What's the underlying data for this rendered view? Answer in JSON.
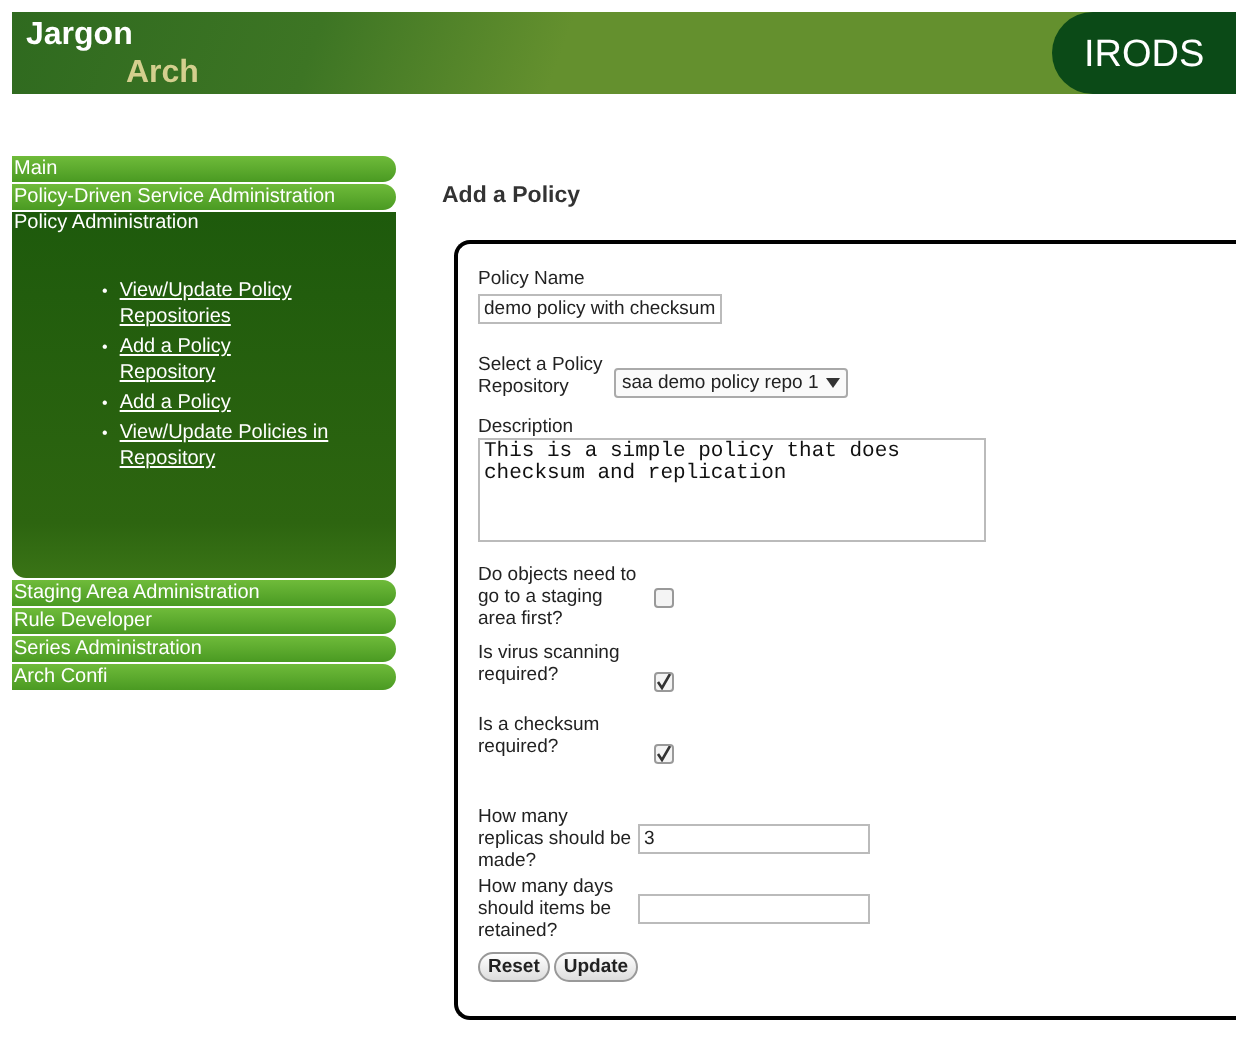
{
  "header": {
    "logo_line_1": "Jargon",
    "logo_line_2": "Arch",
    "badge": "IRODS"
  },
  "nav": [
    {
      "label": "Main",
      "expanded": false
    },
    {
      "label": "Policy-Driven Service Administration",
      "expanded": false
    },
    {
      "label": "Policy Administration",
      "expanded": true,
      "children": [
        {
          "marker": "•",
          "label": "View/Update Policy Repositories"
        },
        {
          "marker": "•",
          "label": "Add a Policy Repository"
        },
        {
          "marker": "•",
          "label": "Add a Policy"
        },
        {
          "marker": "•",
          "label": "View/Update Policies in Repository"
        }
      ]
    },
    {
      "label": "Staging Area Administration",
      "expanded": false
    },
    {
      "label": "Rule Developer",
      "expanded": false
    },
    {
      "label": "Series Administration",
      "expanded": false
    },
    {
      "label": "Arch Confi",
      "expanded": false
    }
  ],
  "page_title": "Add a Policy",
  "fields": [
    {
      "kind": "text",
      "label": "Policy Name",
      "value": "demo policy with checksum"
    },
    {
      "kind": "select",
      "label": "Select a Policy Repository",
      "value": "saa demo policy repo 1"
    },
    {
      "kind": "textarea",
      "label": "Description",
      "value": "This is a simple policy that does checksum and replication"
    },
    {
      "kind": "checkbox",
      "label": "Do objects need to go to a staging area first?",
      "checked": false
    },
    {
      "kind": "checkbox",
      "label": "Is virus scanning required?",
      "checked": true
    },
    {
      "kind": "checkbox",
      "label": "Is a checksum required?",
      "checked": true
    },
    {
      "kind": "inline",
      "label": "How many replicas should be made?",
      "value": "3"
    },
    {
      "kind": "inline",
      "label": "How many days should items be retained?"
    }
  ],
  "buttons": [
    "Reset",
    "Update"
  ]
}
